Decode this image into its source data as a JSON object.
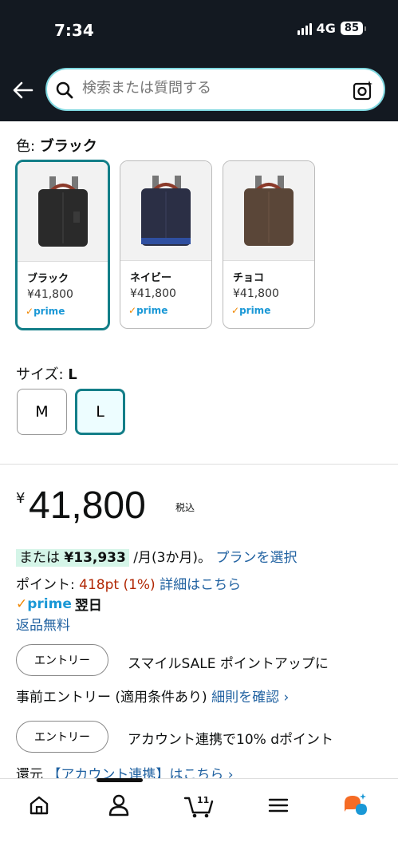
{
  "status_bar": {
    "time": "7:34",
    "network": "4G",
    "battery": "85"
  },
  "search": {
    "placeholder": "検索または質問する"
  },
  "color": {
    "label": "色: ",
    "selected": "ブラック",
    "options": [
      {
        "name": "ブラック",
        "price": "¥41,800",
        "prime": "prime",
        "color": "#2a2a2a"
      },
      {
        "name": "ネイビー",
        "price": "¥41,800",
        "prime": "prime",
        "color": "#2b2f45"
      },
      {
        "name": "チョコ",
        "price": "¥41,800",
        "prime": "prime",
        "color": "#5a4638"
      }
    ]
  },
  "size": {
    "label": "サイズ: ",
    "selected": "L",
    "options": [
      "M",
      "L"
    ]
  },
  "price": {
    "yen": "¥",
    "amount": "41,800",
    "tax": "税込"
  },
  "installment": {
    "prefix": "または ",
    "amount": "¥13,933",
    "suffix": " /月(3か月)。",
    "link": "プランを選択"
  },
  "points": {
    "label": "ポイント: ",
    "value": "418pt",
    "percent": "(1%)",
    "link": "詳細はこちら"
  },
  "prime_delivery": {
    "logo": "prime",
    "text": "翌日"
  },
  "free_return": "返品無料",
  "promotions": [
    {
      "button": "エントリー",
      "text": "スマイルSALE ポイントアップに",
      "cont": "事前エントリー (適用条件あり)",
      "link": "細則を確認 ›"
    },
    {
      "button": "エントリー",
      "text": "アカウント連携で10% dポイント",
      "cont": "還元",
      "link": "【アカウント連携】はこちら ›"
    }
  ],
  "bottom_nav": {
    "cart_count": "11"
  },
  "colors": {
    "header_bg": "#131921",
    "accent": "#137e88",
    "link": "#2162a1",
    "price_red": "#b12704"
  }
}
